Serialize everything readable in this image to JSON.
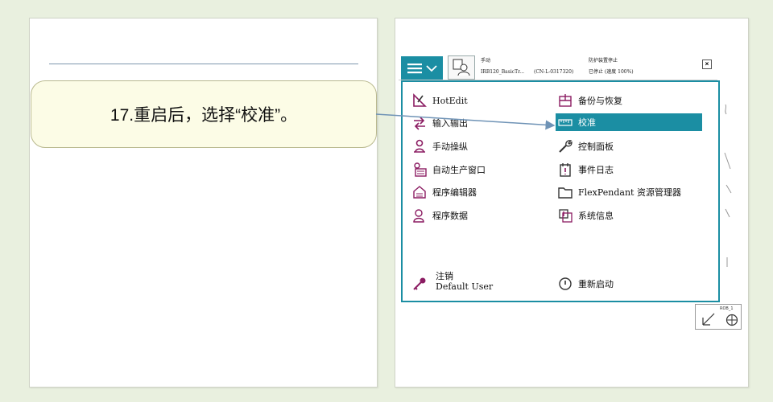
{
  "slide": {
    "callout_text": "17.重启后，选择“校准”。"
  },
  "flexpendant": {
    "status": {
      "mode": "手动",
      "device": "IRB120_BasicTr...",
      "serial": "(CN-L-0317320)",
      "guard_state": "防护装置停止",
      "run_state": "已停止 (速度 100%)"
    },
    "menu_left": [
      {
        "label": "HotEdit",
        "icon": "hotedit-icon"
      },
      {
        "label": "输入输出",
        "icon": "io-icon"
      },
      {
        "label": "手动操纵",
        "icon": "jogging-icon"
      },
      {
        "label": "自动生产窗口",
        "icon": "production-window-icon"
      },
      {
        "label": "程序编辑器",
        "icon": "program-editor-icon"
      },
      {
        "label": "程序数据",
        "icon": "program-data-icon"
      }
    ],
    "menu_right": [
      {
        "label": "备份与恢复",
        "icon": "backup-restore-icon"
      },
      {
        "label": "校准",
        "icon": "calibration-icon",
        "selected": true
      },
      {
        "label": "控制面板",
        "icon": "control-panel-icon"
      },
      {
        "label": "事件日志",
        "icon": "event-log-icon"
      },
      {
        "label": "FlexPendant 资源管理器",
        "icon": "explorer-icon"
      },
      {
        "label": "系统信息",
        "icon": "system-info-icon"
      }
    ],
    "logoff": {
      "label": "注销",
      "user": "Default User"
    },
    "restart": {
      "label": "重新启动"
    },
    "corner_tag": "ROB_1"
  },
  "colors": {
    "accent": "#1b8ea3",
    "icon": "#8b1c62",
    "arrow": "#6f93b6",
    "background": "#e9f0df",
    "callout_fill": "#fcfce6"
  }
}
